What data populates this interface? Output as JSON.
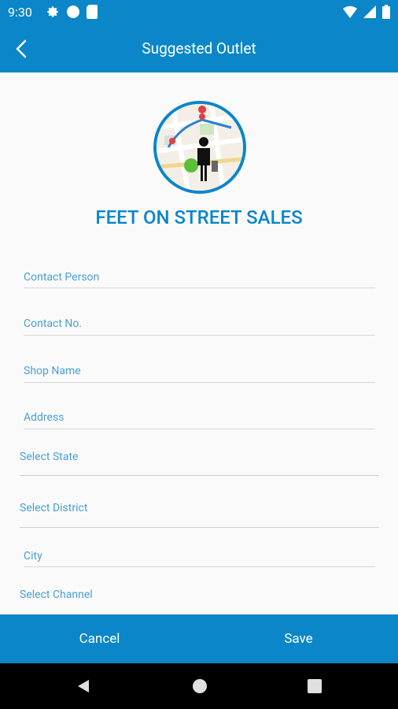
{
  "status": {
    "time": "9:30",
    "icons": [
      "gear-icon",
      "circle-icon",
      "sd-card-icon",
      "wifi-icon",
      "signal-icon",
      "battery-icon"
    ]
  },
  "header": {
    "title": "Suggested Outlet"
  },
  "brand": {
    "title": "FEET ON STREET SALES"
  },
  "form": {
    "contact_person": "Contact Person",
    "contact_no": "Contact No.",
    "shop_name": "Shop Name",
    "address": "Address",
    "select_state": "Select State",
    "select_district": "Select District",
    "city": "City",
    "select_channel": "Select Channel"
  },
  "actions": {
    "cancel": "Cancel",
    "save": "Save"
  },
  "colors": {
    "primary": "#0a86c9",
    "hint": "#4a9fd6",
    "background": "#fafafa"
  }
}
